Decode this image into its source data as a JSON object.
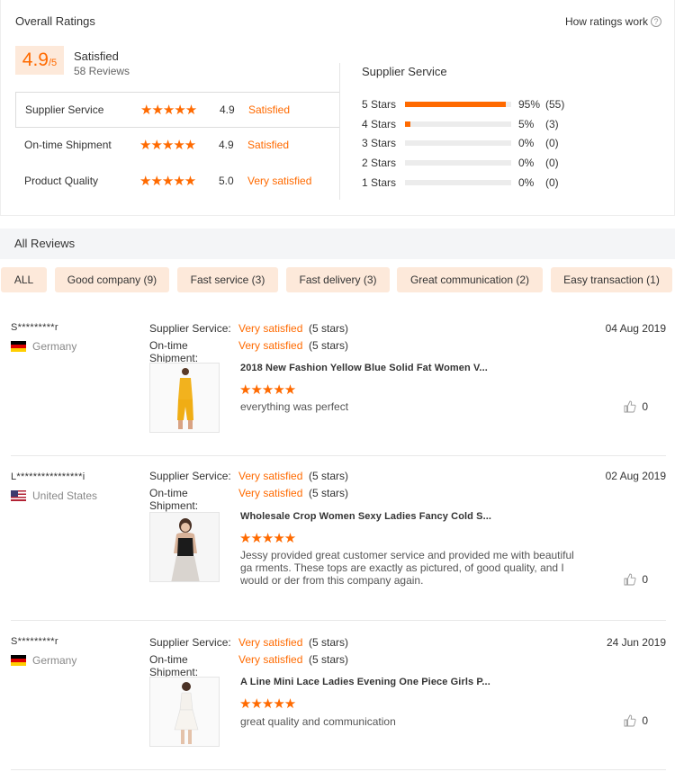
{
  "overall": {
    "title": "Overall Ratings",
    "how_link": "How ratings work",
    "score": "4.9",
    "score_den": "/5",
    "score_label": "Satisfied",
    "review_count": "58 Reviews",
    "ratings": [
      {
        "name": "Supplier Service",
        "stars": 5,
        "value": "4.9",
        "word": "Satisfied"
      },
      {
        "name": "On-time Shipment",
        "stars": 5,
        "value": "4.9",
        "word": "Satisfied"
      },
      {
        "name": "Product Quality",
        "stars": 5,
        "value": "5.0",
        "word": "Very satisfied"
      }
    ],
    "distribution_title": "Supplier Service",
    "distribution": [
      {
        "label": "5 Stars",
        "pct": "95%",
        "count": "(55)",
        "fraction": 0.95
      },
      {
        "label": "4 Stars",
        "pct": "5%",
        "count": "(3)",
        "fraction": 0.05
      },
      {
        "label": "3 Stars",
        "pct": "0%",
        "count": "(0)",
        "fraction": 0
      },
      {
        "label": "2 Stars",
        "pct": "0%",
        "count": "(0)",
        "fraction": 0
      },
      {
        "label": "1 Stars",
        "pct": "0%",
        "count": "(0)",
        "fraction": 0
      }
    ]
  },
  "all_reviews": {
    "title": "All Reviews",
    "filters": [
      "ALL",
      "Good company (9)",
      "Fast service (3)",
      "Fast delivery (3)",
      "Great communication (2)",
      "Easy transaction (1)"
    ]
  },
  "meta_labels": {
    "supplier": "Supplier Service:",
    "shipment": "On-time Shipment:"
  },
  "reviews": [
    {
      "reviewer": "S*********r",
      "country": "Germany",
      "flag": "de",
      "supplier_value": "Very satisfied",
      "supplier_stars": "(5 stars)",
      "shipment_value": "Very satisfied",
      "shipment_stars": "(5 stars)",
      "date": "04 Aug 2019",
      "product_title": "2018 New Fashion Yellow Blue Solid Fat Women V...",
      "product_rating": 5,
      "text": "everything was perfect",
      "likes": "0"
    },
    {
      "reviewer": "L****************i",
      "country": "United States",
      "flag": "us",
      "supplier_value": "Very satisfied",
      "supplier_stars": "(5 stars)",
      "shipment_value": "Very satisfied",
      "shipment_stars": "(5 stars)",
      "date": "02 Aug 2019",
      "product_title": "Wholesale Crop Women Sexy Ladies Fancy Cold S...",
      "product_rating": 5,
      "text": "Jessy provided great customer service and provided me with beautiful ga rments. These tops are exactly as pictured, of good quality, and I would or der from this company again.",
      "likes": "0"
    },
    {
      "reviewer": "S*********r",
      "country": "Germany",
      "flag": "de",
      "supplier_value": "Very satisfied",
      "supplier_stars": "(5 stars)",
      "shipment_value": "Very satisfied",
      "shipment_stars": "(5 stars)",
      "date": "24 Jun 2019",
      "product_title": "A Line Mini Lace Ladies Evening One Piece Girls P...",
      "product_rating": 5,
      "text": "great quality and communication",
      "likes": "0"
    }
  ],
  "colors": {
    "accent": "#ff6a00",
    "chip_bg": "#fde9da"
  }
}
